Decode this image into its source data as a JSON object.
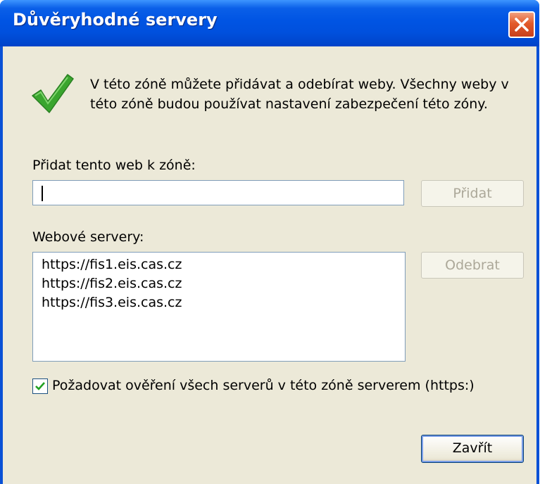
{
  "window": {
    "title": "Důvěryhodné servery"
  },
  "info": {
    "text": "V této zóně můžete přidávat a odebírat weby. Všechny weby v této zóně budou používat nastavení zabezpečení této zóny."
  },
  "add_site": {
    "label": "Přidat tento web k zóně:",
    "value": "",
    "button_label": "Přidat"
  },
  "sites": {
    "label": "Webové servery:",
    "items": [
      "https://fis1.eis.cas.cz",
      "https://fis2.eis.cas.cz",
      "https://fis3.eis.cas.cz"
    ],
    "remove_label": "Odebrat"
  },
  "require_https": {
    "label": "Požadovat ověření všech serverů v této zóně serverem (https:)",
    "checked": true
  },
  "close_button_label": "Zavřít",
  "colors": {
    "titlebar": "#0054e3",
    "face": "#ece9d8",
    "check_green": "#3aa52e"
  }
}
